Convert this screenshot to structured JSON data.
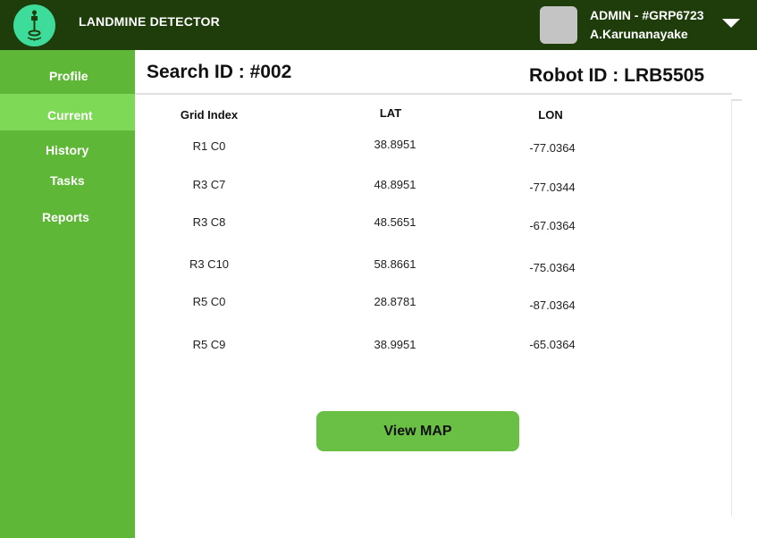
{
  "header": {
    "app_title": "LANDMINE DETECTOR",
    "admin_id": "ADMIN - #GRP6723",
    "admin_name": "A.Karunanayake"
  },
  "sidebar": {
    "items": [
      {
        "label": "Profile",
        "active": false
      },
      {
        "label": "Current",
        "active": true
      },
      {
        "label": "History",
        "active": false
      },
      {
        "label": "Tasks",
        "active": false
      },
      {
        "label": "Reports",
        "active": false
      }
    ]
  },
  "main": {
    "search_id": "Search ID : #002",
    "robot_id": "Robot ID : LRB5505",
    "table": {
      "columns": [
        "Grid Index",
        "LAT",
        "LON"
      ],
      "rows": [
        [
          "R1 C0",
          "38.8951",
          "-77.0364"
        ],
        [
          "R3 C7",
          "48.8951",
          "-77.0344"
        ],
        [
          "R3 C8",
          "48.5651",
          "-67.0364"
        ],
        [
          "R3 C10",
          "58.8661",
          "-75.0364"
        ],
        [
          "R5 C0",
          "28.8781",
          "-87.0364"
        ],
        [
          "R5 C9",
          "38.9951",
          "-65.0364"
        ]
      ]
    },
    "map_button": "View MAP"
  },
  "colors": {
    "topbar": "#1e3d0a",
    "sidebar": "#5fb737",
    "sidebar_active": "#7ed956",
    "logo": "#3ddc9a",
    "button": "#6abf45"
  },
  "icons": [
    "detector-logo-icon",
    "chevron-down-icon"
  ]
}
